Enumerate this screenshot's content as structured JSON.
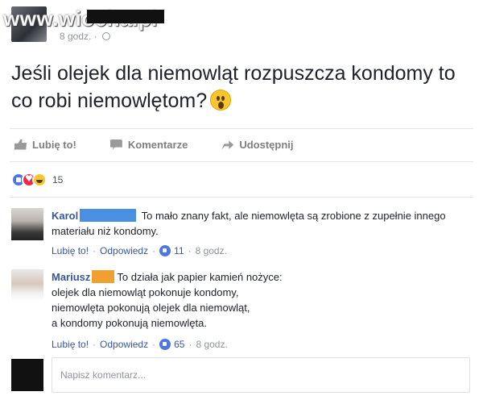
{
  "header": {
    "watermark": "www.wiocha.pl",
    "time": "8 godz. ·"
  },
  "post": {
    "text": "Jeśli olejek dla niemowląt rozpuszcza kondomy to co robi niemowlętom?"
  },
  "actions": {
    "like": "Lubię to!",
    "comment": "Komentarze",
    "share": "Udostępnij"
  },
  "reactions": {
    "count": "15"
  },
  "comments": [
    {
      "name": "Karol",
      "text": "To mało znany fakt, ale niemowlęta są zrobione z zupełnie innego materiału niż kondomy.",
      "like": "Lubię to!",
      "reply": "Odpowiedz",
      "likes": "11",
      "time": "8 godz."
    },
    {
      "name": "Mariusz",
      "line1": "To działa jak papier kamień nożyce:",
      "line2": "olejek dla niemowląt pokonuje kondomy,",
      "line3": "niemowlęta pokonują olejek dla niemowląt,",
      "line4": "a kondomy pokonują niemowlęta.",
      "like": "Lubię to!",
      "reply": "Odpowiedz",
      "likes": "65",
      "time": "8 godz."
    }
  ],
  "compose": {
    "placeholder": "Napisz komentarz..."
  },
  "colors": {
    "link": "#365899",
    "like_blue": "#4a76e8",
    "redact_blue": "#4a90e2",
    "redact_orange": "#f0a030"
  },
  "icons": [
    "wow-emoji-icon",
    "thumbs-up-icon",
    "comment-icon",
    "share-arrow-icon",
    "globe-icon",
    "like-reaction-icon",
    "love-reaction-icon",
    "haha-reaction-icon"
  ]
}
